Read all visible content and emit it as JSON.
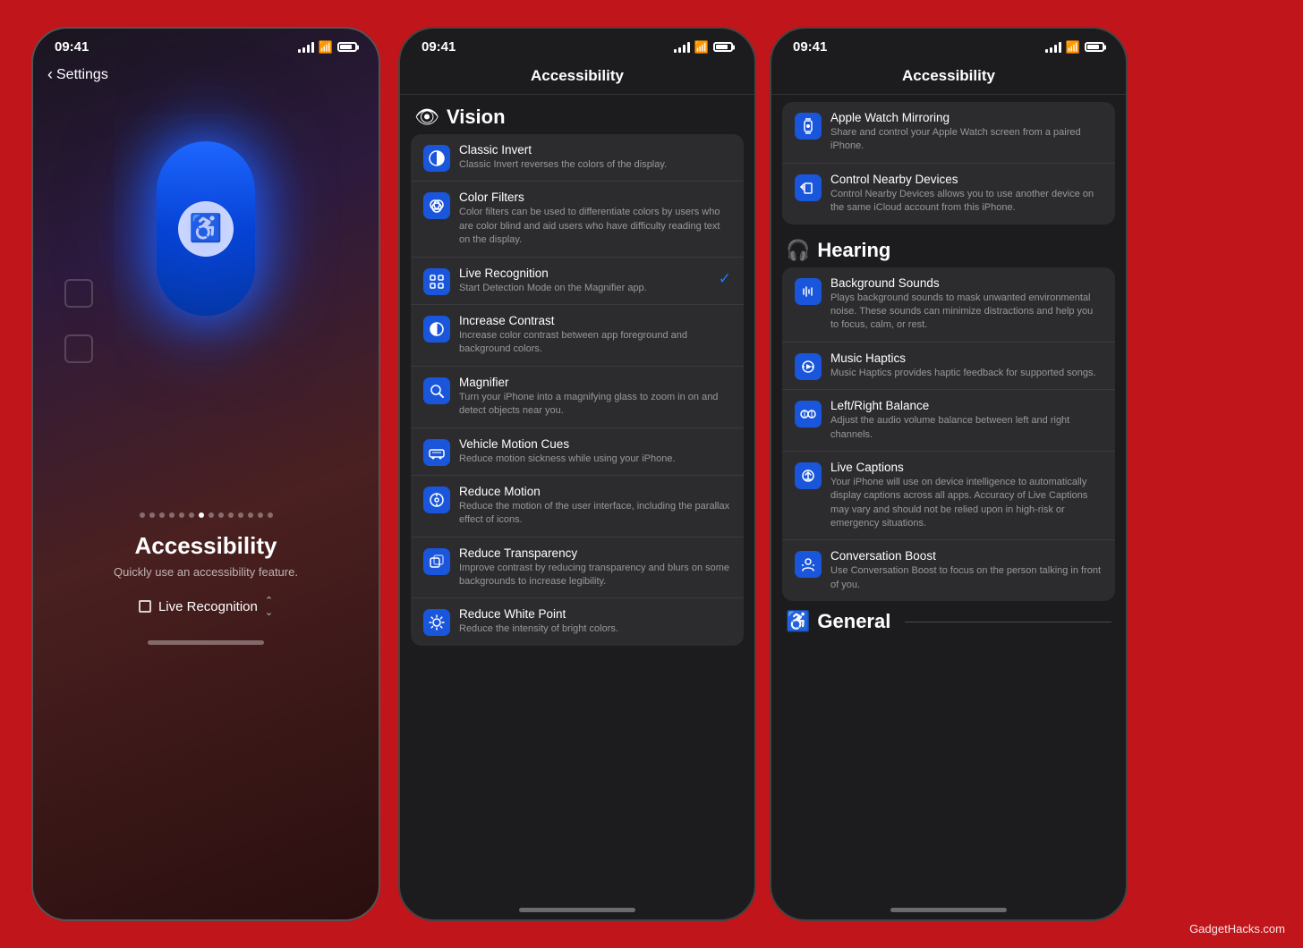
{
  "brand": "GadgetHacks.com",
  "phones": [
    {
      "id": "phone1",
      "time": "09:41",
      "back_label": "Settings",
      "title": "Accessibility",
      "subtitle": "Quickly use an accessibility feature.",
      "feature_label": "Live Recognition",
      "dots": 14,
      "active_dot": 7
    },
    {
      "id": "phone2",
      "time": "09:41",
      "nav_title": "Accessibility",
      "section": "Vision",
      "items": [
        {
          "title": "Classic Invert",
          "desc": "Classic Invert reverses the colors of the display.",
          "icon_type": "split-circle"
        },
        {
          "title": "Color Filters",
          "desc": "Color filters can be used to differentiate colors by users who are color blind and aid users who have difficulty reading text on the display.",
          "icon_type": "rings"
        },
        {
          "title": "Live Recognition",
          "desc": "Start Detection Mode on the Magnifier app.",
          "icon_type": "corners",
          "checked": true
        },
        {
          "title": "Increase Contrast",
          "desc": "Increase color contrast between app foreground and background colors.",
          "icon_type": "half-circle"
        },
        {
          "title": "Magnifier",
          "desc": "Turn your iPhone into a magnifying glass to zoom in on and detect objects near you.",
          "icon_type": "magnifier"
        },
        {
          "title": "Vehicle Motion Cues",
          "desc": "Reduce motion sickness while using your iPhone.",
          "icon_type": "car"
        },
        {
          "title": "Reduce Motion",
          "desc": "Reduce the motion of the user interface, including the parallax effect of icons.",
          "icon_type": "motion"
        },
        {
          "title": "Reduce Transparency",
          "desc": "Improve contrast by reducing transparency and blurs on some backgrounds to increase legibility.",
          "icon_type": "transparency"
        },
        {
          "title": "Reduce White Point",
          "desc": "Reduce the intensity of bright colors.",
          "icon_type": "brightness"
        }
      ]
    },
    {
      "id": "phone3",
      "time": "09:41",
      "nav_title": "Accessibility",
      "top_items": [
        {
          "title": "Apple Watch Mirroring",
          "desc": "Share and control your Apple Watch screen from a paired iPhone.",
          "icon_type": "watch"
        },
        {
          "title": "Control Nearby Devices",
          "desc": "Control Nearby Devices allows you to use another device on the same iCloud account from this iPhone.",
          "icon_type": "device"
        }
      ],
      "hearing_section": "Hearing",
      "hearing_items": [
        {
          "title": "Background Sounds",
          "desc": "Plays background sounds to mask unwanted environmental noise. These sounds can minimize distractions and help you to focus, calm, or rest.",
          "icon_type": "music"
        },
        {
          "title": "Music Haptics",
          "desc": "Music Haptics provides haptic feedback for supported songs.",
          "icon_type": "haptics"
        },
        {
          "title": "Left/Right Balance",
          "desc": "Adjust the audio volume balance between left and right channels.",
          "icon_type": "headphones"
        },
        {
          "title": "Live Captions",
          "desc": "Your iPhone will use on device intelligence to automatically display captions across all apps. Accuracy of Live Captions may vary and should not be relied upon in high-risk or emergency situations.",
          "icon_type": "captions"
        },
        {
          "title": "Conversation Boost",
          "desc": "Use Conversation Boost to focus on the person talking in front of you.",
          "icon_type": "conversation"
        }
      ],
      "general_section": "General"
    }
  ]
}
